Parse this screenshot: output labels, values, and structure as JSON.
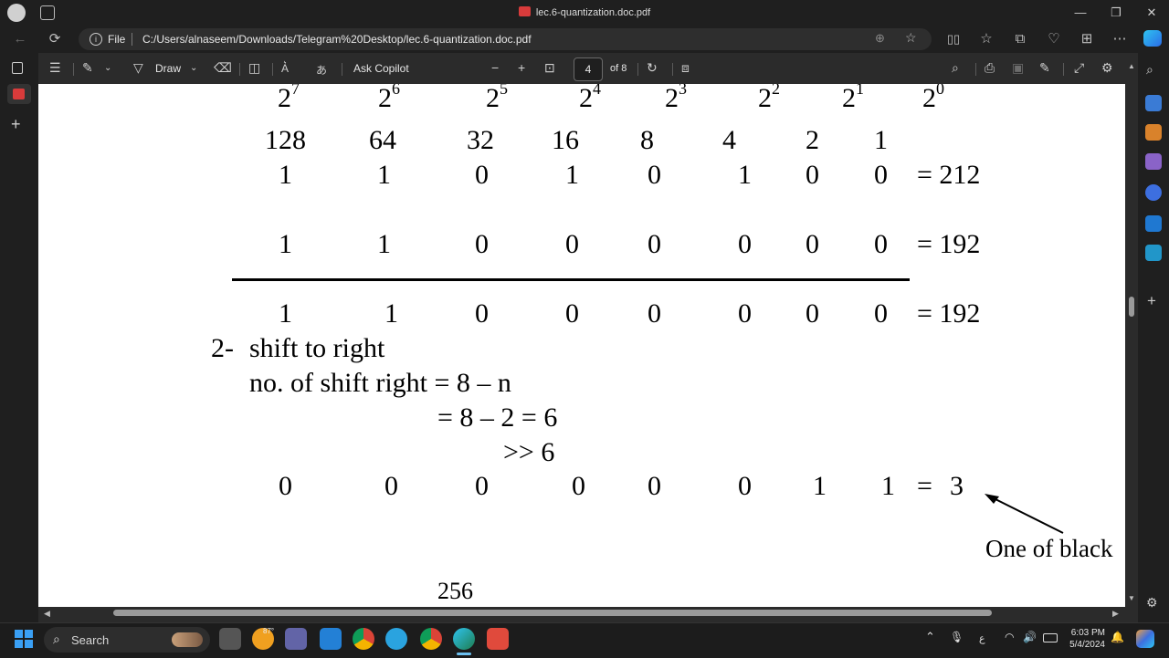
{
  "window": {
    "title": "lec.6-quantization.doc.pdf",
    "min_glyph": "—",
    "max_glyph": "❐",
    "close_glyph": "✕"
  },
  "address": {
    "file_label": "File",
    "url": "C:/Users/alnaseem/Downloads/Telegram%20Desktop/lec.6-quantization.doc.pdf"
  },
  "pdf_toolbar": {
    "draw_label": "Draw",
    "ask_copilot_label": "Ask Copilot",
    "current_page": "4",
    "page_count": "of 8",
    "zoom_out": "−",
    "zoom_in": "+"
  },
  "document": {
    "powers": [
      {
        "base": "2",
        "exp": "7"
      },
      {
        "base": "2",
        "exp": "6"
      },
      {
        "base": "2",
        "exp": "5"
      },
      {
        "base": "2",
        "exp": "4"
      },
      {
        "base": "2",
        "exp": "3"
      },
      {
        "base": "2",
        "exp": "2"
      },
      {
        "base": "2",
        "exp": "1"
      },
      {
        "base": "2",
        "exp": "0"
      }
    ],
    "place_values": [
      "128",
      "64",
      "32",
      "16",
      "8",
      "4",
      "2",
      "1"
    ],
    "row1": {
      "bits": [
        "1",
        "1",
        "0",
        "1",
        "0",
        "1",
        "0",
        "0"
      ],
      "result": "= 212"
    },
    "row2": {
      "bits": [
        "1",
        "1",
        "0",
        "0",
        "0",
        "0",
        "0",
        "0"
      ],
      "result": "= 192"
    },
    "row3": {
      "bits": [
        "1",
        "1",
        "0",
        "0",
        "0",
        "0",
        "0",
        "0"
      ],
      "result": "= 192"
    },
    "step_number": "2-",
    "step_title": "shift to right",
    "formula_line1": "no. of shift right = 8 – n",
    "formula_line2": "= 8 – 2 = 6",
    "formula_line3": ">> 6",
    "row4": {
      "bits": [
        "0",
        "0",
        "0",
        "0",
        "0",
        "0",
        "1",
        "1"
      ],
      "eq": "=",
      "result": "3"
    },
    "annotation": "One of  black",
    "bottom_value": "256"
  },
  "taskbar": {
    "search_label": "Search",
    "weather_temp": "87°",
    "time": "6:03 PM",
    "date": "5/4/2024",
    "lang": "ع"
  },
  "colors": {
    "chrome_bg": "#1f1f1f",
    "toolbar_bg": "#2b2b2b",
    "page_bg": "#ffffff",
    "pdf_red": "#d83b3b"
  }
}
